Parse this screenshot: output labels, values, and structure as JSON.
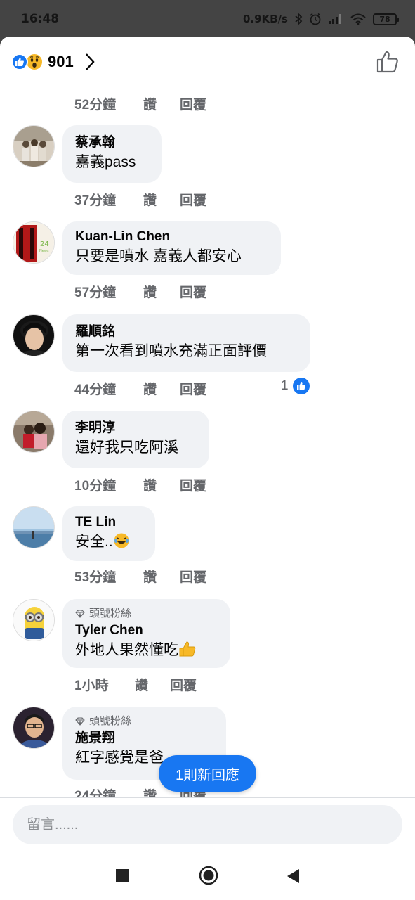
{
  "status_bar": {
    "time": "16:48",
    "network_speed": "0.9KB/s",
    "battery": "78",
    "icons": [
      "bluetooth-icon",
      "alarm-icon",
      "signal-icon",
      "wifi-icon",
      "battery-icon"
    ]
  },
  "header": {
    "reaction_count": "901",
    "reactions": [
      "like-reaction",
      "wow-reaction"
    ],
    "colors": {
      "like": "#1877f2",
      "wow": "#f7b928"
    }
  },
  "actions": {
    "like": "讚",
    "reply": "回覆"
  },
  "top_meta": {
    "time": "52分鐘"
  },
  "comments": [
    {
      "name": "蔡承翰",
      "text": "嘉義pass",
      "time": "37分鐘"
    },
    {
      "name": "Kuan-Lin Chen",
      "text": "只要是噴水 嘉義人都安心",
      "time": "57分鐘"
    },
    {
      "name": "羅順銘",
      "text": "第一次看到噴水充滿正面評價",
      "time": "44分鐘",
      "likes": "1"
    },
    {
      "name": "李明淳",
      "text": "還好我只吃阿溪",
      "time": "10分鐘"
    },
    {
      "name": "TE Lin",
      "text": "安全..",
      "time": "53分鐘"
    },
    {
      "badge": "頭號粉絲",
      "name": "Tyler Chen",
      "text": "外地人果然懂吃",
      "time": "1小時"
    },
    {
      "badge": "頭號粉絲",
      "name": "施景翔",
      "text": "紅字感覺是爸",
      "time": "24分鐘"
    }
  ],
  "new_reply_button": "1則新回應",
  "composer": {
    "placeholder": "留言......"
  },
  "colors": {
    "accent": "#1877f2",
    "bubble": "#f0f2f5",
    "meta_text": "#65676b"
  }
}
